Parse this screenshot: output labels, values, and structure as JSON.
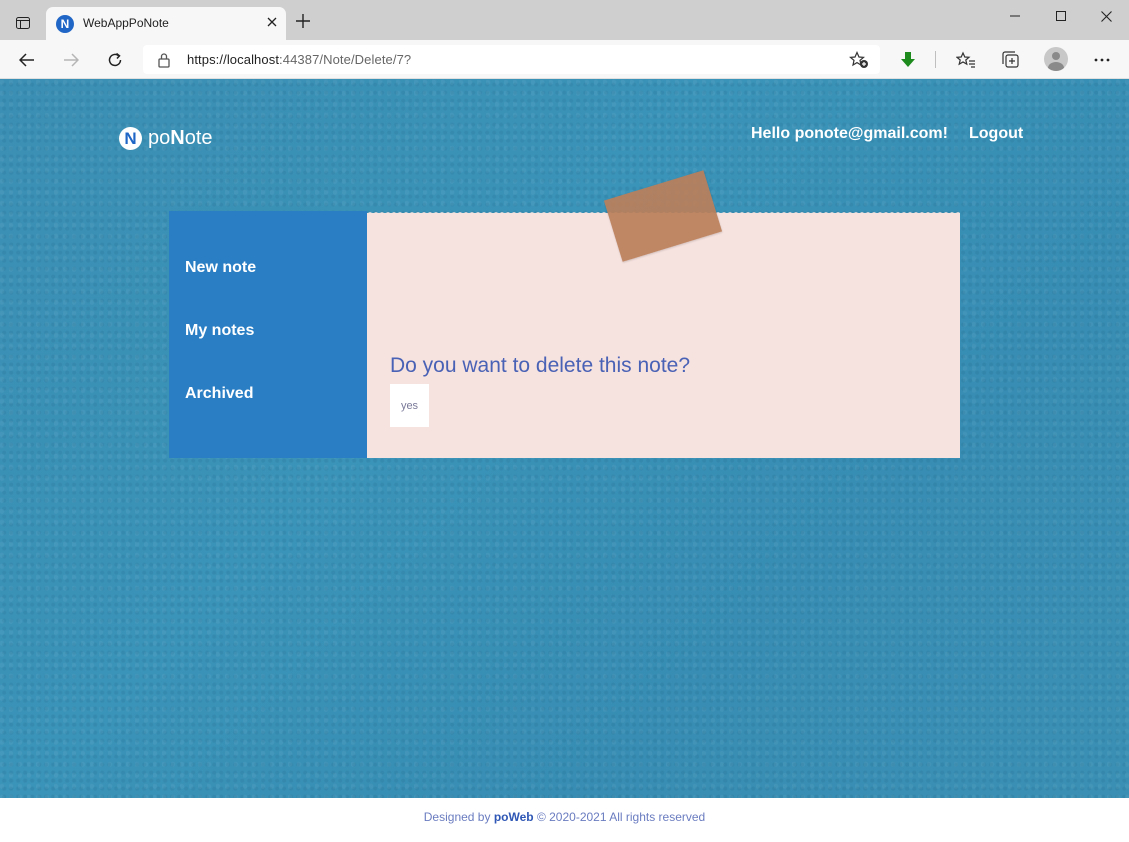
{
  "browser": {
    "tab_title": "WebAppPoNote",
    "tab_favicon_letter": "N",
    "url_host": "https://localhost",
    "url_rest": ":44387/Note/Delete/7?",
    "icons": {
      "tab_actions": "tab-actions-icon",
      "close_tab": "close-icon",
      "new_tab": "plus-icon",
      "minimize": "minimize-icon",
      "maximize": "maximize-icon",
      "close_window": "close-icon",
      "back": "back-arrow-icon",
      "forward": "forward-arrow-icon",
      "refresh": "refresh-icon",
      "lock": "lock-icon",
      "add_favorite": "star-plus-icon",
      "download": "download-icon",
      "favorites": "favorites-icon",
      "collections": "collections-icon",
      "profile": "avatar-icon",
      "more": "more-icon"
    }
  },
  "header": {
    "logo_letter": "N",
    "logo_prefix": "po",
    "logo_suffix_bold": "N",
    "logo_suffix": "ote",
    "greeting": "Hello ponote@gmail.com!",
    "logout_label": "Logout"
  },
  "sidebar": {
    "items": [
      {
        "label": "New note"
      },
      {
        "label": "My notes"
      },
      {
        "label": "Archived"
      }
    ]
  },
  "note": {
    "question": "Do you want to delete this note?",
    "confirm_label": "yes"
  },
  "footer": {
    "prefix": "Designed by",
    "brand": "poWeb",
    "suffix": "© 2020-2021 All rights reserved"
  },
  "colors": {
    "background": "#3a90b4",
    "sidebar": "#2a7fc4",
    "note": "#f6e2df",
    "tape": "#bb7f5a",
    "question_text": "#4a62b5",
    "footer_text": "#6a7cc0"
  }
}
